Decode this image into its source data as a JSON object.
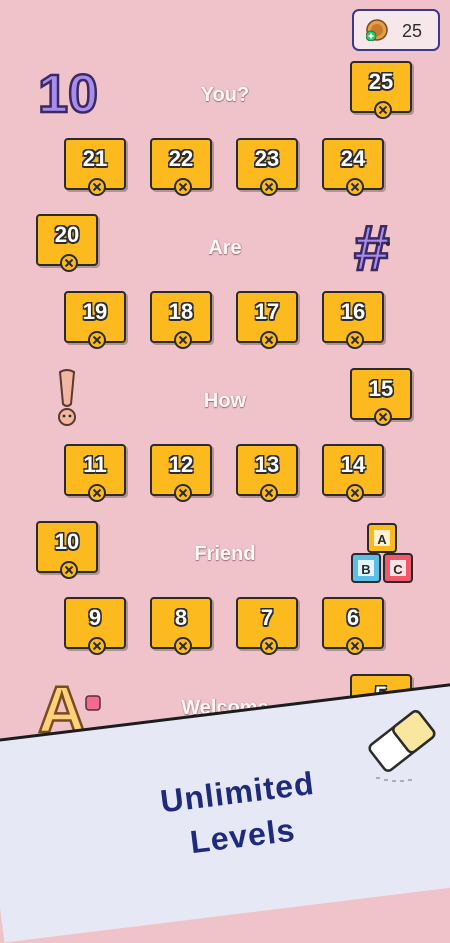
{
  "coins": {
    "value": "25",
    "icon": "coin-plus-icon"
  },
  "words": [
    {
      "label": "You?"
    },
    {
      "label": "Are"
    },
    {
      "label": "How"
    },
    {
      "label": "Friend"
    },
    {
      "label": "Welcome"
    }
  ],
  "levels": {
    "l25": "25",
    "l24": "24",
    "l23": "23",
    "l22": "22",
    "l21": "21",
    "l20": "20",
    "l19": "19",
    "l18": "18",
    "l17": "17",
    "l16": "16",
    "l15": "15",
    "l14": "14",
    "l13": "13",
    "l12": "12",
    "l11": "11",
    "l10": "10",
    "l9": "9",
    "l8": "8",
    "l7": "7",
    "l6": "6",
    "l5": "5"
  },
  "decorations": {
    "ten": "10",
    "hash": "#",
    "exclamation": "!",
    "blocks": [
      "A",
      "B",
      "C"
    ],
    "letter_a": "A"
  },
  "promo": {
    "line1": "Unlimited",
    "line2": "Levels"
  },
  "colors": {
    "background": "#EFC3C9",
    "tile": "#FDBA1E",
    "outline": "#2B2B2B",
    "accent": "#1E2A7A"
  }
}
